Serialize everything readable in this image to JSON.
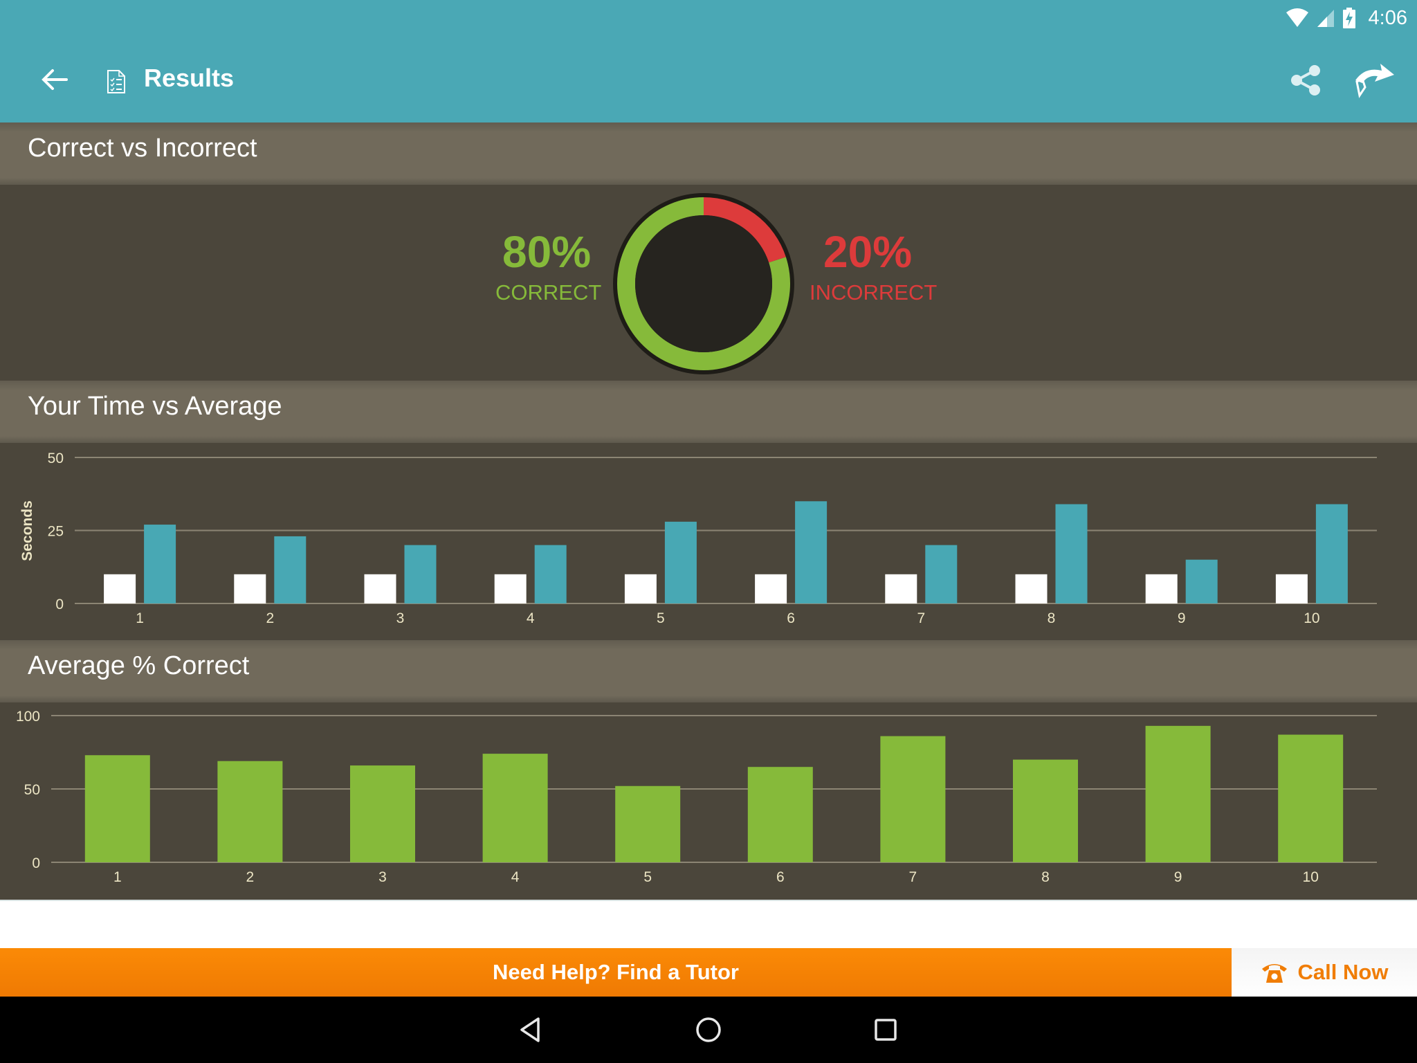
{
  "status_bar": {
    "time": "4:06",
    "icons": [
      "wifi-icon",
      "cell-signal-icon",
      "battery-charging-icon"
    ]
  },
  "app_bar": {
    "title": "Results",
    "icons": [
      "back-arrow-icon",
      "document-checklist-icon",
      "share-icon",
      "brand-logo-icon"
    ]
  },
  "colors": {
    "toolbar": "#4aa8b5",
    "panel": "#4b463b",
    "section_header": "#716a5b",
    "correct": "#86ba3a",
    "incorrect": "#dd3b3b",
    "your_time_bar": "#ffffff",
    "average_bar": "#48a8b4",
    "tutor_bar": "#f7830a"
  },
  "sections": {
    "correct_vs_incorrect": {
      "title": "Correct vs Incorrect",
      "correct_value": "80%",
      "correct_label": "CORRECT",
      "incorrect_value": "20%",
      "incorrect_label": "INCORRECT"
    },
    "time_vs_average": {
      "title": "Your Time vs Average"
    },
    "average_correct": {
      "title": "Average % Correct"
    }
  },
  "chart_data": [
    {
      "type": "pie",
      "title": "Correct vs Incorrect",
      "categories": [
        "Correct",
        "Incorrect"
      ],
      "values": [
        80,
        20
      ],
      "colors": [
        "#86ba3a",
        "#dd3b3b"
      ],
      "style": "donut"
    },
    {
      "type": "bar",
      "title": "Your Time vs Average",
      "xlabel": "",
      "ylabel": "Seconds",
      "categories": [
        "1",
        "2",
        "3",
        "4",
        "5",
        "6",
        "7",
        "8",
        "9",
        "10"
      ],
      "series": [
        {
          "name": "Your Time",
          "color": "#ffffff",
          "values": [
            10,
            10,
            10,
            10,
            10,
            10,
            10,
            10,
            10,
            10
          ]
        },
        {
          "name": "Average",
          "color": "#48a8b4",
          "values": [
            27,
            23,
            20,
            20,
            28,
            35,
            20,
            34,
            15,
            34
          ]
        }
      ],
      "ylim": [
        0,
        50
      ],
      "yticks": [
        "0",
        "25",
        "50"
      ],
      "ytick_values": [
        0,
        25,
        50
      ],
      "grid": true,
      "legend": "none"
    },
    {
      "type": "bar",
      "title": "Average % Correct",
      "xlabel": "",
      "ylabel": "",
      "categories": [
        "1",
        "2",
        "3",
        "4",
        "5",
        "6",
        "7",
        "8",
        "9",
        "10"
      ],
      "series": [
        {
          "name": "Average % Correct",
          "color": "#86ba3a",
          "values": [
            73,
            69,
            66,
            74,
            52,
            65,
            86,
            70,
            93,
            87
          ]
        }
      ],
      "ylim": [
        0,
        100
      ],
      "yticks": [
        "0",
        "50",
        "100"
      ],
      "ytick_values": [
        0,
        50,
        100
      ],
      "grid": true,
      "legend": "none"
    }
  ],
  "footer": {
    "tutor_label": "Need Help? Find a Tutor",
    "call_label": "Call Now"
  },
  "nav_bar": {
    "icons": [
      "nav-back-icon",
      "nav-home-icon",
      "nav-recents-icon"
    ]
  }
}
